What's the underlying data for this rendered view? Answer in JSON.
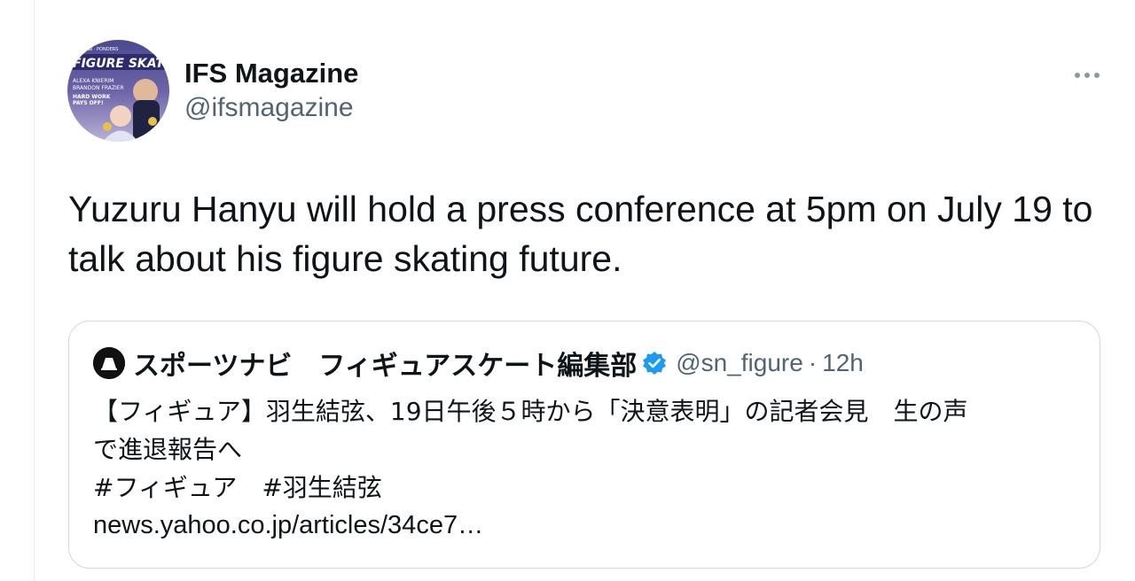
{
  "tweet": {
    "author": {
      "display_name": "IFS Magazine",
      "handle": "@ifsmagazine",
      "avatar_icon": "magazine-cover-avatar"
    },
    "more_icon": "more-dots-icon",
    "text": "Yuzuru Hanyu will hold a press conference at 5pm on July 19 to talk about his figure skating future."
  },
  "quoted_tweet": {
    "author": {
      "display_name": "スポーツナビ　フィギュアスケート編集部",
      "handle": "@sn_figure",
      "verified_icon": "verified-badge-icon",
      "avatar_icon": "sportsnavi-logo-avatar"
    },
    "separator": "·",
    "time": "12h",
    "body_lines": [
      "【フィギュア】羽生結弦、19日午後５時から「決意表明」の記者会見　生の声",
      "で進退報告へ",
      "#フィギュア　#羽生結弦",
      "news.yahoo.co.jp/articles/34ce7…"
    ]
  },
  "colors": {
    "text_primary": "#0f1419",
    "text_secondary": "#536471",
    "border": "#cfd9de",
    "verified": "#1d9bf0"
  }
}
